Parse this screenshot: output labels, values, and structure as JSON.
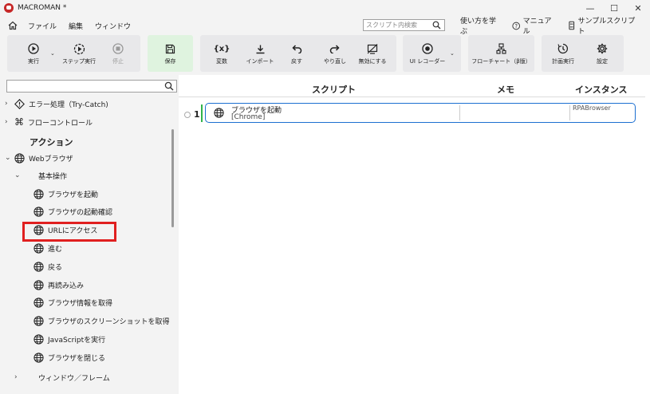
{
  "window": {
    "title": "MACROMAN *",
    "controls": {
      "minimize": "—",
      "maximize": "☐",
      "close": "✕"
    }
  },
  "menubar": {
    "items": [
      "ファイル",
      "編集",
      "ウィンドウ"
    ],
    "search_placeholder": "スクリプト内検索",
    "help_links": [
      "使い方を学ぶ",
      "マニュアル",
      "サンプルスクリプト"
    ]
  },
  "toolbar": {
    "run": "実行",
    "step_run": "ステップ実行",
    "stop": "停止",
    "save": "保存",
    "variable": "変数",
    "import": "インポート",
    "undo": "戻す",
    "redo": "やり直し",
    "disable": "無効にする",
    "ui_recorder": "UI レコーダー",
    "flowchart": "フローチャート（β版）",
    "schedule": "計画実行",
    "settings": "設定"
  },
  "tree": {
    "search_placeholder": "",
    "items": [
      {
        "label": "エラー処理（Try-Catch)",
        "icon": "diamond-warning-icon"
      },
      {
        "label": "フローコントロール",
        "icon": "command-icon"
      }
    ],
    "section": "アクション",
    "category": "Webブラウザ",
    "subcategory": "基本操作",
    "actions": [
      "ブラウザを起動",
      "ブラウザの起動確認",
      "URLにアクセス",
      "進む",
      "戻る",
      "再読み込み",
      "ブラウザ情報を取得",
      "ブラウザのスクリーンショットを取得",
      "JavaScriptを実行",
      "ブラウザを閉じる"
    ],
    "next_subcategory": "ウィンドウ／フレーム"
  },
  "script": {
    "columns": [
      "スクリプト",
      "メモ",
      "インスタンス"
    ],
    "rows": [
      {
        "num": "1",
        "title": "ブラウザを起動",
        "param": "[Chrome]",
        "memo": "",
        "instance": "RPABrowser"
      }
    ]
  },
  "colors": {
    "accent_blue": "#1c6fd1",
    "save_green": "#dff3df",
    "highlight_red": "#e02020",
    "active_bar_green": "#31b34a"
  }
}
